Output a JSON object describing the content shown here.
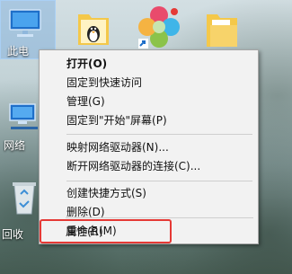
{
  "desktop": {
    "icons": [
      {
        "name": "this-pc",
        "label": "此电",
        "icon": "monitor-icon"
      },
      {
        "name": "network",
        "label": "网络",
        "icon": "network-icon"
      },
      {
        "name": "recycle-bin",
        "label": "回收",
        "icon": "recycle-bin-icon"
      },
      {
        "name": "qq-shortcut",
        "label": "",
        "icon": "penguin-folder-icon"
      },
      {
        "name": "color-app",
        "label": "",
        "icon": "colorful-app-icon"
      },
      {
        "name": "folder",
        "label": "",
        "icon": "folder-icon"
      }
    ]
  },
  "context_menu": {
    "items": [
      {
        "label": "打开(O)",
        "bold": true
      },
      {
        "label": "固定到快速访问"
      },
      {
        "label": "管理(G)"
      },
      {
        "label": "固定到\"开始\"屏幕(P)"
      },
      {
        "label": "映射网络驱动器(N)..."
      },
      {
        "label": "断开网络驱动器的连接(C)..."
      },
      {
        "label": "创建快捷方式(S)"
      },
      {
        "label": "删除(D)"
      },
      {
        "label": "重命名(M)"
      },
      {
        "label": "属性(R)"
      }
    ]
  },
  "colors": {
    "highlight": "#e53935",
    "menu_bg": "#f2f2f2"
  }
}
